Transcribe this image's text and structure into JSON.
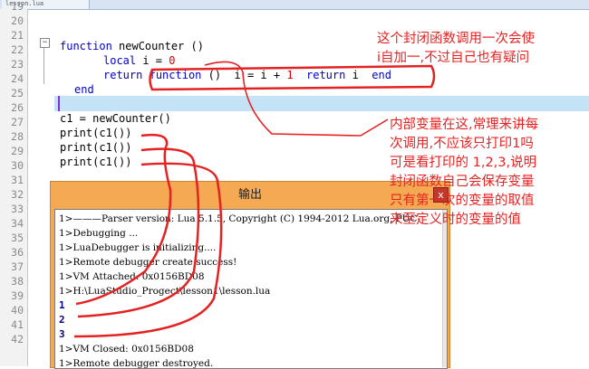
{
  "tab": {
    "title": "lesson.lua"
  },
  "line_numbers": [
    "19",
    "20",
    "21",
    "22",
    "23",
    "24",
    "25",
    "26",
    "27",
    "28",
    "29",
    "30",
    "31",
    "32",
    "33",
    "34",
    "35",
    "36",
    "37",
    "38",
    "39",
    "40",
    "41",
    "42"
  ],
  "code": {
    "l21_kw": "function",
    "l21_name": " newCounter ()",
    "l22_kw": "local",
    "l22_rest": " i = ",
    "l22_num": "0",
    "l23_kw": "return",
    "l23_kw2": "function",
    "l23_rest1": " ()  i = i + ",
    "l23_num": "1",
    "l23_kw3": "return",
    "l23_rest2": " i  ",
    "l23_kw4": "end",
    "l24_kw": "end",
    "l26": "c1 = newCounter()",
    "l27": "print(c1())",
    "l28": "print(c1())",
    "l29": "print(c1())"
  },
  "annotations": {
    "top": [
      "这个封闭函数调用一次会使",
      "i自加一,不过自己也有疑问"
    ],
    "middle": [
      "内部变量在这,常理来讲每",
      "次调用,不应该只打印1吗",
      "可是看打印的 1,2,3,说明",
      "封闭函数自己会保存变量",
      "只有第一次的变量的取值",
      "来至定义时的变量的值"
    ]
  },
  "output": {
    "title": "输出",
    "close": "x",
    "lines": [
      "1>———Parser version: Lua 5.1.5, Copyright (C) 1994-2012 Lua.org, PUC-",
      "1>Debugging ...",
      "1>LuaDebugger is initializing....",
      "1>Remote debugger create success!",
      "1>VM Attached: 0x0156BD08",
      "1>H:\\LuaStudio_Progect\\lesson1\\lesson.lua",
      "1",
      "2",
      "3",
      "1>VM Closed: 0x0156BD08",
      "1>Remote debugger destroyed."
    ]
  },
  "colors": {
    "keyword": "#0000c8",
    "number": "#d60000",
    "annotation": "#e52222",
    "output_title_bg": "#f4a952",
    "current_line": "#c5e3f7"
  }
}
